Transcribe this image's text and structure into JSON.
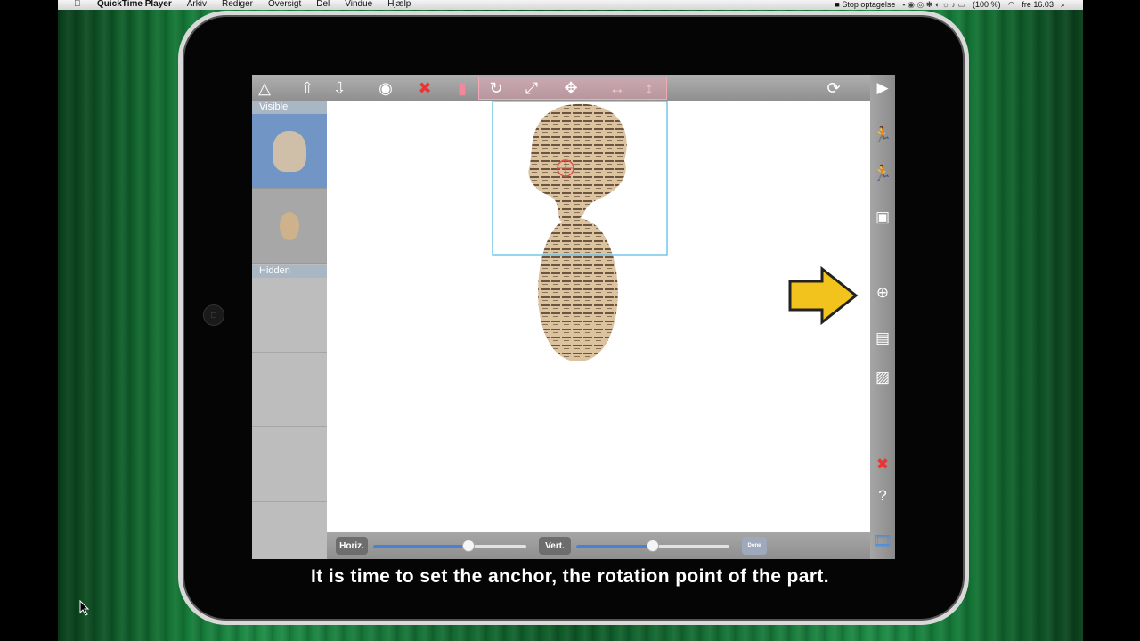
{
  "menubar": {
    "app_name": "QuickTime Player",
    "menus": [
      "Arkiv",
      "Rediger",
      "Oversigt",
      "Del",
      "Vindue",
      "Hjælp"
    ],
    "status": {
      "recording": "Stop optagelse",
      "battery": "(100 %)",
      "clock": "fre 16.03"
    }
  },
  "app": {
    "toolbar_icons": [
      "arrow-up-outline-icon",
      "arrow-up-icon",
      "arrow-down-icon",
      "eye-icon",
      "delete-icon",
      "layer-icon",
      "rotate-icon",
      "expand-icon",
      "move-icon",
      "horizontal-move-icon",
      "vertical-move-icon",
      "undo-icon",
      "play-icon"
    ],
    "panel": {
      "visible_label": "Visible",
      "hidden_label": "Hidden"
    },
    "sidebar_icons": [
      "puppet-icon",
      "puppet-2-icon",
      "image-icon",
      "anchor-icon",
      "save-icon",
      "export-icon",
      "delete-puppet-icon",
      "help-icon",
      "film-icon"
    ],
    "bottom": {
      "horiz_label": "Horiz.",
      "vert_label": "Vert.",
      "done_label": "Done",
      "horiz_value": 0.62,
      "vert_value": 0.5
    }
  },
  "colors": {
    "accent": "#4a7fd6",
    "selection": "#7195c5",
    "arrow": "#f2c31c"
  },
  "subtitle": "It is time to set the anchor, the rotation point of the part."
}
